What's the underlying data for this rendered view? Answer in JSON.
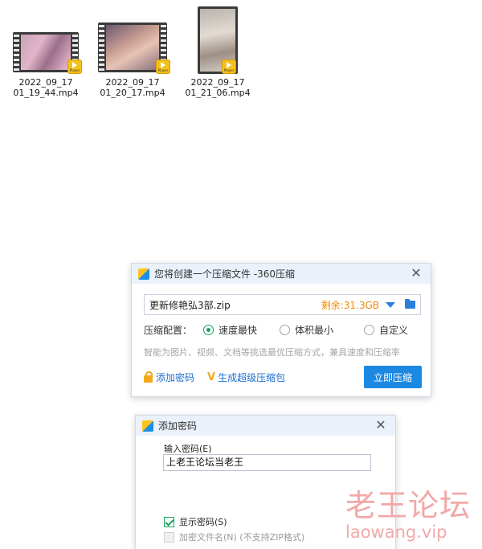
{
  "files": [
    {
      "name_line1": "2022_09_17",
      "name_line2": "01_19_44.mp4",
      "badge": "Player"
    },
    {
      "name_line1": "2022_09_17",
      "name_line2": "01_20_17.mp4",
      "badge": "Player"
    },
    {
      "name_line1": "2022_09_17",
      "name_line2": "01_21_06.mp4",
      "badge": "Player"
    }
  ],
  "compress_dialog": {
    "title": "您将创建一个压缩文件 -360压缩",
    "close": "✕",
    "filename": "更新修艳弘3部.zip",
    "free_space": "剩余:31.3GB",
    "config_label": "压缩配置：",
    "options": [
      "速度最快",
      "体积最小",
      "自定义"
    ],
    "selected_option": "速度最快",
    "hint": "智能为图片、视频、文档等挑选最优压缩方式，兼具速度和压缩率",
    "add_password": "添加密码",
    "super_pack": "生成超级压缩包",
    "compress_button": "立即压缩"
  },
  "password_dialog": {
    "title": "添加密码",
    "close": "✕",
    "input_label": "输入密码(E)",
    "password_value": "上老王论坛当老王",
    "show_password": "显示密码(S)",
    "encrypt_names": "加密文件名(N) (不支持ZIP格式)"
  },
  "watermark": {
    "cn": "老王论坛",
    "en": "laowang.vip"
  },
  "colors": {
    "accent": "#1b88e2",
    "free_space": "#f08a00",
    "radio_on": "#1aa260",
    "watermark": "#f2a8a8"
  }
}
